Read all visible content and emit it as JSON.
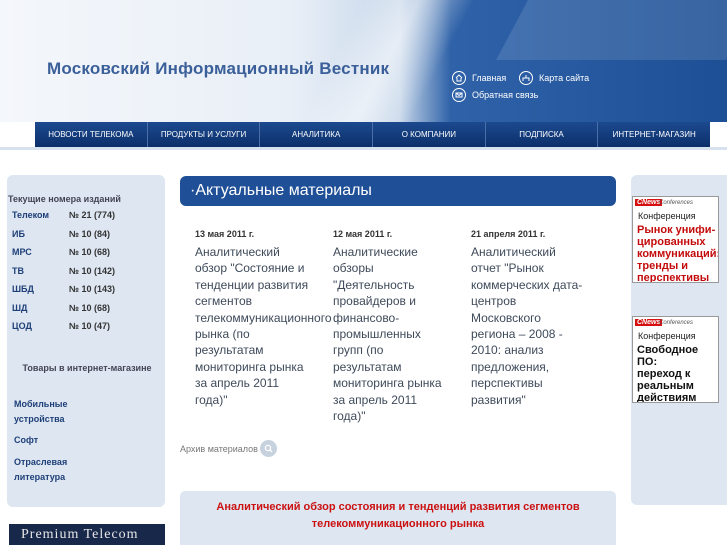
{
  "header": {
    "logo": "Московский Информационный Вестник",
    "links": [
      {
        "label": "Главная",
        "icon": "home-icon"
      },
      {
        "label": "Карта сайта",
        "icon": "sitemap-icon"
      },
      {
        "label": "Обратная связь",
        "icon": "mail-icon"
      }
    ]
  },
  "nav": [
    "Новости телекома",
    "Продукты и услуги",
    "Аналитика",
    "О компании",
    "Подписка",
    "Интернет-магазин"
  ],
  "sidebar": {
    "editions_title": "Текущие номера изданий",
    "editions": [
      {
        "name": "Телеком",
        "number": "№ 21 (774)"
      },
      {
        "name": "ИБ",
        "number": "№ 10 (84)"
      },
      {
        "name": "МРС",
        "number": "№ 10 (68)"
      },
      {
        "name": "ТВ",
        "number": "№ 10 (142)"
      },
      {
        "name": "ШБД",
        "number": "№ 10 (143)"
      },
      {
        "name": "ШД",
        "number": "№ 10 (68)"
      },
      {
        "name": "ЦОД",
        "number": "№ 10 (47)"
      }
    ],
    "shop_title": "Товары в интернет-магазине",
    "shop_items": [
      "Мобильные устройства",
      "Софт",
      "Отраслевая литература"
    ],
    "premium_banner": "Premium Telecom"
  },
  "main": {
    "section_title": "·Актуальные материалы",
    "articles": [
      {
        "date": "13 мая 2011 г.",
        "text": "Аналитический\nобзор \"Состояние и\nтенденции развития\nсегментов\nтелекоммуникационного\nрынка (по\nрезультатам\nмониторинга рынка\nза апрель 2011\nгода)\""
      },
      {
        "date": "12 мая 2011 г.",
        "text": "Аналитические\nобзоры\n\"Деятельность\nпровайдеров и\nфинансово-\nпромышленных\nгрупп (по\nрезультатам\nмониторинга рынка\nза апрель 2011\nгода)\""
      },
      {
        "date": "21 апреля 2011 г.",
        "text": "Аналитический\nотчет \"Рынок\nкоммерческих дата-\nцентров\nМосковского\nрегиона – 2008 -\n2010: анализ\nпредложения,\nперспективы\nразвития\""
      }
    ],
    "archive_label": "Архив материалов",
    "feature_text": "Аналитический обзор состояния и тенденций развития сегментов телекоммуникационного рынка"
  },
  "banners": [
    {
      "brand": "CNews",
      "label": "Conferences",
      "kind": "Конференция",
      "title": "Рынок унифи-\nцированных\nкоммуникаций:\nтренды и\nперспективы"
    },
    {
      "brand": "CNews",
      "label": "Conferences",
      "kind": "Конференция",
      "title": "Свободное ПО:\nпереход к\nреальным\nдействиям"
    }
  ],
  "colors": {
    "nav_bg": "#0f3778",
    "section_bg": "#1f4f96",
    "sidebar_bg": "#dde6f1",
    "accent_red": "#cc1111",
    "link_blue": "#1e3f78"
  }
}
